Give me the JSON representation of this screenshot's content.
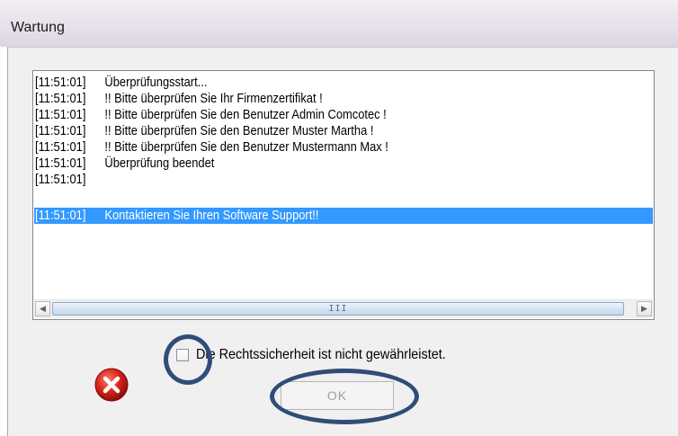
{
  "window": {
    "title": "Wartung"
  },
  "log": {
    "lines": [
      {
        "time": "[11:51:01]",
        "text": "Überprüfungsstart..."
      },
      {
        "time": "[11:51:01]",
        "text": "!! Bitte überprüfen Sie Ihr Firmenzertifikat !"
      },
      {
        "time": "[11:51:01]",
        "text": "!! Bitte überprüfen Sie den Benutzer Admin Comcotec !"
      },
      {
        "time": "[11:51:01]",
        "text": "!! Bitte überprüfen Sie den Benutzer Muster Martha !"
      },
      {
        "time": "[11:51:01]",
        "text": "!! Bitte überprüfen Sie den Benutzer Mustermann Max !"
      },
      {
        "time": "[11:51:01]",
        "text": "Überprüfung beendet"
      },
      {
        "time": "[11:51:01]",
        "text": ""
      },
      {
        "time": "[11:51:01]",
        "text": "Kontaktieren Sie Ihren Software Support!!"
      }
    ],
    "selected_index": 7,
    "selection_color": "#3399ff"
  },
  "scrollbar": {
    "grip": "III"
  },
  "status": {
    "icon": "error-icon",
    "checkbox_checked": false,
    "checkbox_label": "Die Rechtssicherheit ist nicht gewährleistet."
  },
  "ok_button": {
    "label": "OK",
    "enabled": false
  },
  "annotation_color": "#2f4d78"
}
